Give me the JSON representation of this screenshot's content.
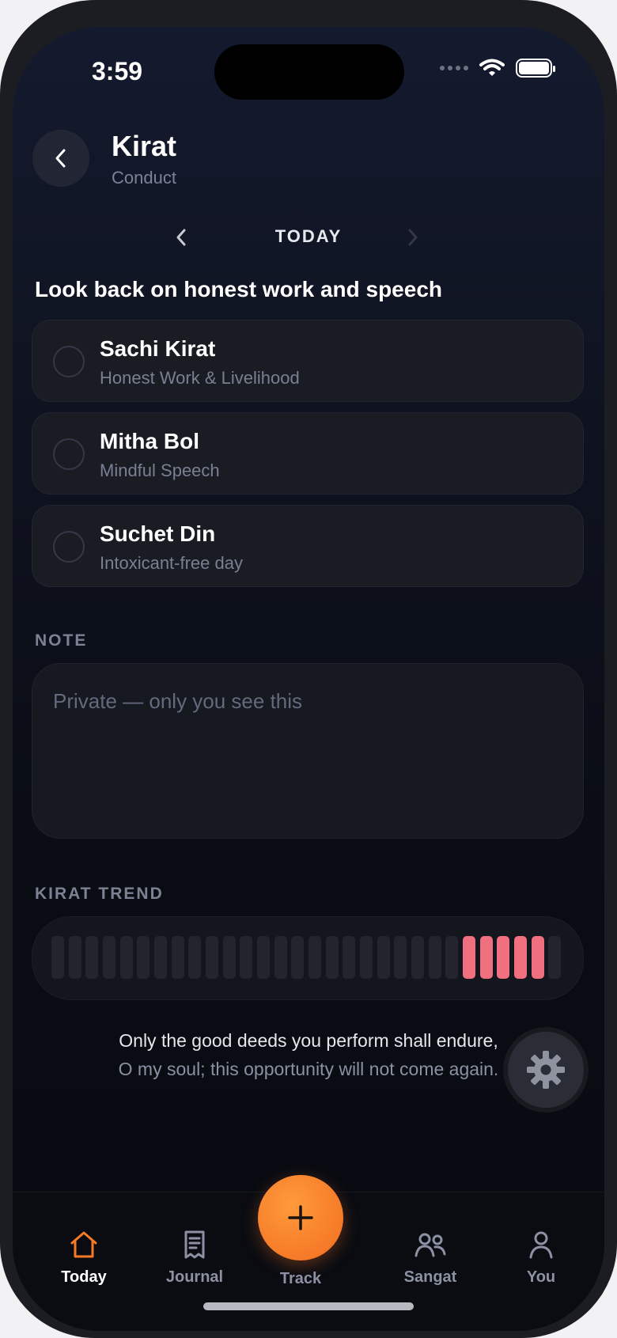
{
  "status": {
    "time": "3:59"
  },
  "header": {
    "title": "Kirat",
    "subtitle": "Conduct"
  },
  "date_nav": {
    "label": "TODAY"
  },
  "prompt": "Look back on honest work and speech",
  "habits": [
    {
      "name": "Sachi Kirat",
      "desc": "Honest Work & Livelihood",
      "checked": false
    },
    {
      "name": "Mitha Bol",
      "desc": "Mindful Speech",
      "checked": false
    },
    {
      "name": "Suchet Din",
      "desc": "Intoxicant-free day",
      "checked": false
    }
  ],
  "note": {
    "label": "NOTE",
    "placeholder": "Private — only you see this",
    "value": ""
  },
  "trend": {
    "label": "KIRAT TREND",
    "days": [
      0,
      0,
      0,
      0,
      0,
      0,
      0,
      0,
      0,
      0,
      0,
      0,
      0,
      0,
      0,
      0,
      0,
      0,
      0,
      0,
      0,
      0,
      0,
      0,
      1,
      1,
      1,
      1,
      1,
      0
    ],
    "active_color": "#f0707f",
    "inactive_color": "#22252d"
  },
  "quote": {
    "line1": "Only the good deeds you perform shall endure,",
    "line2": "O my soul; this opportunity will not come again."
  },
  "colors": {
    "accent": "#f57a25"
  },
  "tabs": [
    {
      "label": "Today",
      "icon": "home-icon",
      "active": true
    },
    {
      "label": "Journal",
      "icon": "journal-icon",
      "active": false
    },
    {
      "label": "Track",
      "icon": "plus-icon",
      "active": false
    },
    {
      "label": "Sangat",
      "icon": "people-icon",
      "active": false
    },
    {
      "label": "You",
      "icon": "person-icon",
      "active": false
    }
  ]
}
